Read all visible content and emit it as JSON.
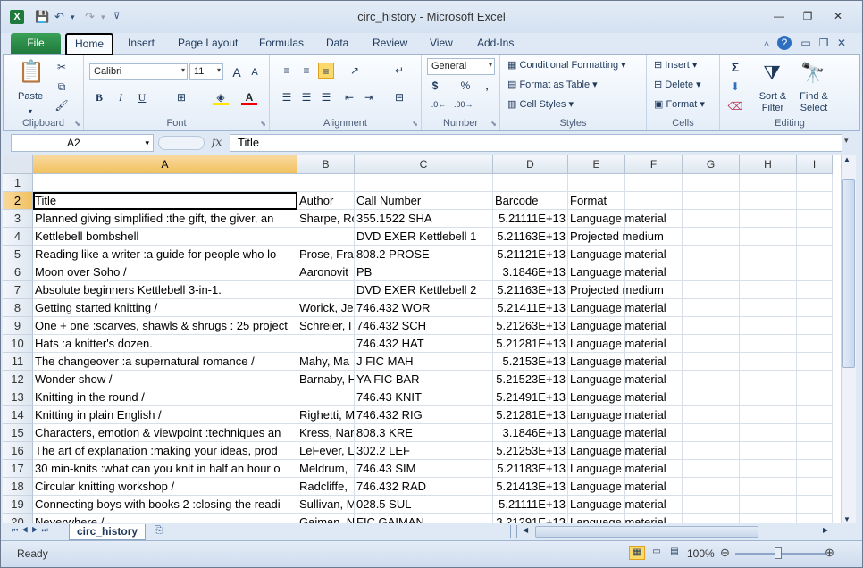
{
  "window": {
    "title": "circ_history  -  Microsoft Excel",
    "excel_logo": "X"
  },
  "ribbon_tabs": [
    "File",
    "Home",
    "Insert",
    "Page Layout",
    "Formulas",
    "Data",
    "Review",
    "View",
    "Add-Ins"
  ],
  "ribbon": {
    "clipboard": {
      "paste_label": "Paste",
      "group_label": "Clipboard"
    },
    "font": {
      "font_name": "Calibri",
      "font_size": "11",
      "group_label": "Font"
    },
    "alignment": {
      "group_label": "Alignment"
    },
    "number": {
      "format": "General",
      "group_label": "Number",
      "currency": "$",
      "percent": "%",
      "comma": ","
    },
    "styles": {
      "conditional": "Conditional Formatting",
      "format_table": "Format as Table",
      "cell_styles": "Cell Styles",
      "group_label": "Styles"
    },
    "cells": {
      "insert": "Insert",
      "delete": "Delete",
      "format": "Format",
      "group_label": "Cells"
    },
    "editing": {
      "sort_filter": "Sort & Filter",
      "find_select": "Find & Select",
      "sigma": "Σ",
      "group_label": "Editing"
    }
  },
  "formula_bar": {
    "name_box": "A2",
    "fx": "fx",
    "formula": "Title"
  },
  "columns": [
    "A",
    "B",
    "C",
    "D",
    "E",
    "F",
    "G",
    "H",
    "I"
  ],
  "rows": [
    {
      "n": "1",
      "a": "",
      "b": "",
      "c": "",
      "d": "",
      "e": ""
    },
    {
      "n": "2",
      "a": "Title",
      "b": "Author",
      "c": "Call Number",
      "d": "Barcode",
      "e": "Format"
    },
    {
      "n": "3",
      "a": "Planned giving simplified :the gift, the giver, an",
      "b": "Sharpe, Ro",
      "c": "355.1522 SHA",
      "d": "5.21111E+13",
      "e": "Language material"
    },
    {
      "n": "4",
      "a": "Kettlebell bombshell",
      "b": "",
      "c": "DVD EXER Kettlebell 1",
      "d": "5.21163E+13",
      "e": "Projected medium"
    },
    {
      "n": "5",
      "a": "Reading like a writer :a guide for people who lo",
      "b": "Prose, Fra",
      "c": "808.2 PROSE",
      "d": "5.21121E+13",
      "e": "Language material"
    },
    {
      "n": "6",
      "a": "Moon over Soho /",
      "b": "Aaronovit",
      "c": "PB",
      "d": "3.1846E+13",
      "e": "Language material"
    },
    {
      "n": "7",
      "a": "Absolute beginners Kettlebell 3-in-1.",
      "b": "",
      "c": "DVD EXER Kettlebell 2",
      "d": "5.21163E+13",
      "e": "Projected medium"
    },
    {
      "n": "8",
      "a": "Getting started knitting /",
      "b": "Worick, Je",
      "c": "746.432 WOR",
      "d": "5.21411E+13",
      "e": "Language material"
    },
    {
      "n": "9",
      "a": "One + one :scarves, shawls & shrugs : 25 project",
      "b": "Schreier, I",
      "c": "746.432 SCH",
      "d": "5.21263E+13",
      "e": "Language material"
    },
    {
      "n": "10",
      "a": "Hats :a knitter's dozen.",
      "b": "",
      "c": "746.432 HAT",
      "d": "5.21281E+13",
      "e": "Language material"
    },
    {
      "n": "11",
      "a": "The changeover :a supernatural romance /",
      "b": "Mahy, Ma",
      "c": "J FIC MAH",
      "d": "5.2153E+13",
      "e": "Language material"
    },
    {
      "n": "12",
      "a": "Wonder show /",
      "b": "Barnaby, H",
      "c": "YA FIC BAR",
      "d": "5.21523E+13",
      "e": "Language material"
    },
    {
      "n": "13",
      "a": "Knitting in the round /",
      "b": "",
      "c": "746.43 KNIT",
      "d": "5.21491E+13",
      "e": "Language material"
    },
    {
      "n": "14",
      "a": "Knitting in plain English /",
      "b": "Righetti, M",
      "c": "746.432 RIG",
      "d": "5.21281E+13",
      "e": "Language material"
    },
    {
      "n": "15",
      "a": "Characters, emotion & viewpoint :techniques an",
      "b": "Kress, Nar",
      "c": "808.3 KRE",
      "d": "3.1846E+13",
      "e": "Language material"
    },
    {
      "n": "16",
      "a": "The art of explanation :making your ideas, prod",
      "b": "LeFever, L",
      "c": "302.2 LEF",
      "d": "5.21253E+13",
      "e": "Language material"
    },
    {
      "n": "17",
      "a": "30 min-knits :what can you knit in half an hour o",
      "b": "Meldrum,",
      "c": "746.43 SIM",
      "d": "5.21183E+13",
      "e": "Language material"
    },
    {
      "n": "18",
      "a": "Circular knitting workshop /",
      "b": "Radcliffe,",
      "c": "746.432 RAD",
      "d": "5.21413E+13",
      "e": "Language material"
    },
    {
      "n": "19",
      "a": "Connecting boys with books 2 :closing the readi",
      "b": "Sullivan, M",
      "c": "028.5 SUL",
      "d": "5.21111E+13",
      "e": "Language material"
    },
    {
      "n": "20",
      "a": "Neverwhere /",
      "b": "Gaiman, N",
      "c": "FIC GAIMAN",
      "d": "3.21291E+13",
      "e": "Language material"
    }
  ],
  "sheet_tab": "circ_history",
  "status": {
    "ready": "Ready",
    "zoom": "100%"
  }
}
